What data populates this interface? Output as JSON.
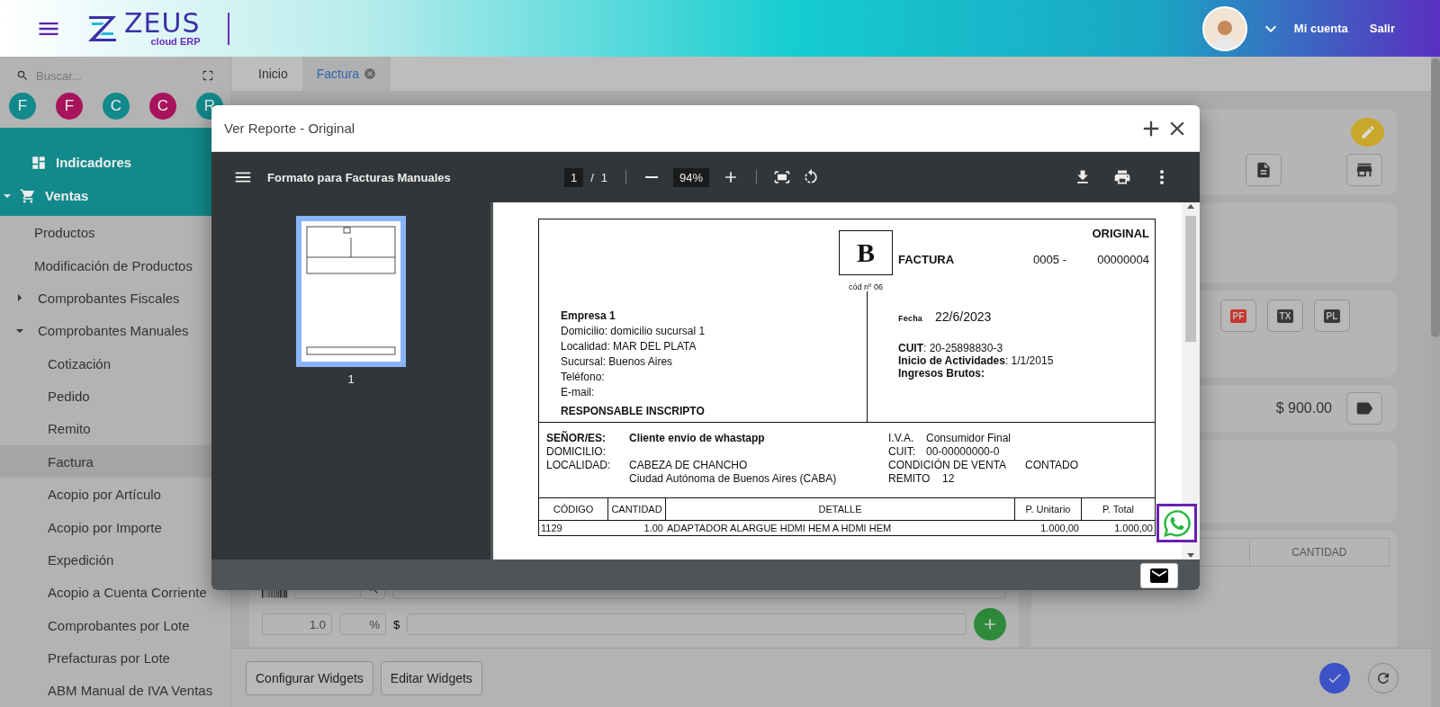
{
  "header": {
    "logo": {
      "name": "ZEUS",
      "tagline": "cloud ERP"
    },
    "account": "Mi cuenta",
    "logout": "Salir"
  },
  "sidebar": {
    "search_placeholder": "Buscar...",
    "shortcuts": [
      {
        "letter": "F",
        "color": "#12898b"
      },
      {
        "letter": "F",
        "color": "#a8145c"
      },
      {
        "letter": "C",
        "color": "#12898b"
      },
      {
        "letter": "C",
        "color": "#a8145c"
      },
      {
        "letter": "R",
        "color": "#12898b"
      }
    ],
    "menu": [
      {
        "label": "Indicadores",
        "kind": "dashboard",
        "selected": false
      },
      {
        "label": "Ventas",
        "kind": "cart",
        "expanded": true,
        "selected": false,
        "children": [
          {
            "label": "Productos",
            "kind": "link",
            "selected": false
          },
          {
            "label": "Modificación de Productos",
            "kind": "link",
            "selected": false
          },
          {
            "label": "Comprobantes Fiscales",
            "kind": "group",
            "expanded": false,
            "selected": false
          },
          {
            "label": "Comprobantes Manuales",
            "kind": "group",
            "expanded": true,
            "selected": false,
            "children": [
              {
                "label": "Cotización",
                "kind": "link",
                "selected": false
              },
              {
                "label": "Pedido",
                "kind": "link",
                "selected": false
              },
              {
                "label": "Remito",
                "kind": "link",
                "selected": false
              },
              {
                "label": "Factura",
                "kind": "link",
                "selected": true
              },
              {
                "label": "Acopio por Artículo",
                "kind": "link",
                "selected": false
              },
              {
                "label": "Acopio por Importe",
                "kind": "link",
                "selected": false
              },
              {
                "label": "Expedición",
                "kind": "link",
                "selected": false
              },
              {
                "label": "Acopio a Cuenta Corriente",
                "kind": "link",
                "selected": false
              },
              {
                "label": "Comprobantes por Lote",
                "kind": "link",
                "selected": false
              },
              {
                "label": "Prefacturas por Lote",
                "kind": "link",
                "selected": false
              },
              {
                "label": "ABM Manual de IVA Ventas",
                "kind": "link",
                "selected": false
              }
            ]
          }
        ]
      }
    ]
  },
  "tabs": [
    {
      "label": "Inicio",
      "selected": false,
      "closable": false
    },
    {
      "label": "Factura",
      "selected": true,
      "closable": true
    }
  ],
  "form": {
    "quantity": "1.0",
    "percent": "%",
    "currency": "$"
  },
  "side_panel": {
    "file_buttons": [
      {
        "label": "PF",
        "color": "#c8372d"
      },
      {
        "label": "TX",
        "color": "#3a3a3a"
      },
      {
        "label": "PL",
        "color": "#3a3a3a"
      }
    ],
    "total": "$ 900.00",
    "table_column": "CANTIDAD"
  },
  "footer": {
    "buttons": [
      "Configurar Widgets",
      "Editar Widgets"
    ]
  },
  "dialog": {
    "title": "Ver Reporte - Original",
    "viewer": {
      "title": "Formato para Facturas Manuales",
      "page": "1",
      "pages": "1",
      "separator": "/",
      "zoom": "94%",
      "thumbnail_label": "1"
    },
    "invoice": {
      "copy": "ORIGINAL",
      "letter": "B",
      "code": "cód nº 06",
      "type": "FACTURA",
      "point": "0005 -",
      "number": "00000004",
      "date_label": "Fecha",
      "date": "22/6/2023",
      "company": {
        "name": "Empresa 1",
        "lines": [
          "Domicilio: domicilio sucursal 1",
          "Localidad: MAR DEL PLATA",
          "Sucursal: Buenos Aires",
          "Teléfono:",
          "E-mail:"
        ],
        "condition": "RESPONSABLE INSCRIPTO"
      },
      "tax_lines": [
        "**CUIT**: 20-25898830-3",
        "**Inicio de Actividades**: 1/1/2015",
        "**Ingresos Brutos:**"
      ],
      "customer_left": [
        {
          "label": "SEÑOR/ES:",
          "value": "Cliente envio de whastapp",
          "bold": true
        },
        {
          "label": "DOMICILIO:",
          "bold": false
        },
        {
          "label": "LOCALIDAD:",
          "value": "CABEZA DE CHANCHO",
          "bold": false
        }
      ],
      "customer_extra": "Ciudad Autónoma de Buenos Aires (CABA)",
      "customer_right": [
        {
          "label": "I.V.A.",
          "value": "Consumidor Final"
        },
        {
          "label": "CUIT:",
          "value": "00-00000000-0"
        },
        {
          "label": "CONDICIÓN DE VENTA",
          "value": "CONTADO"
        },
        {
          "label": "REMITO",
          "value": "12"
        }
      ],
      "columns": [
        "CÓDIGO",
        "CANTIDAD",
        "DETALLE",
        "P. Unitario",
        "P. Total"
      ],
      "rows": [
        [
          "1129",
          "1.00",
          "ADAPTADOR ALARGUE HDMI HEM A HDMI HEM",
          "1.000,00",
          "1.000,00"
        ]
      ]
    }
  }
}
